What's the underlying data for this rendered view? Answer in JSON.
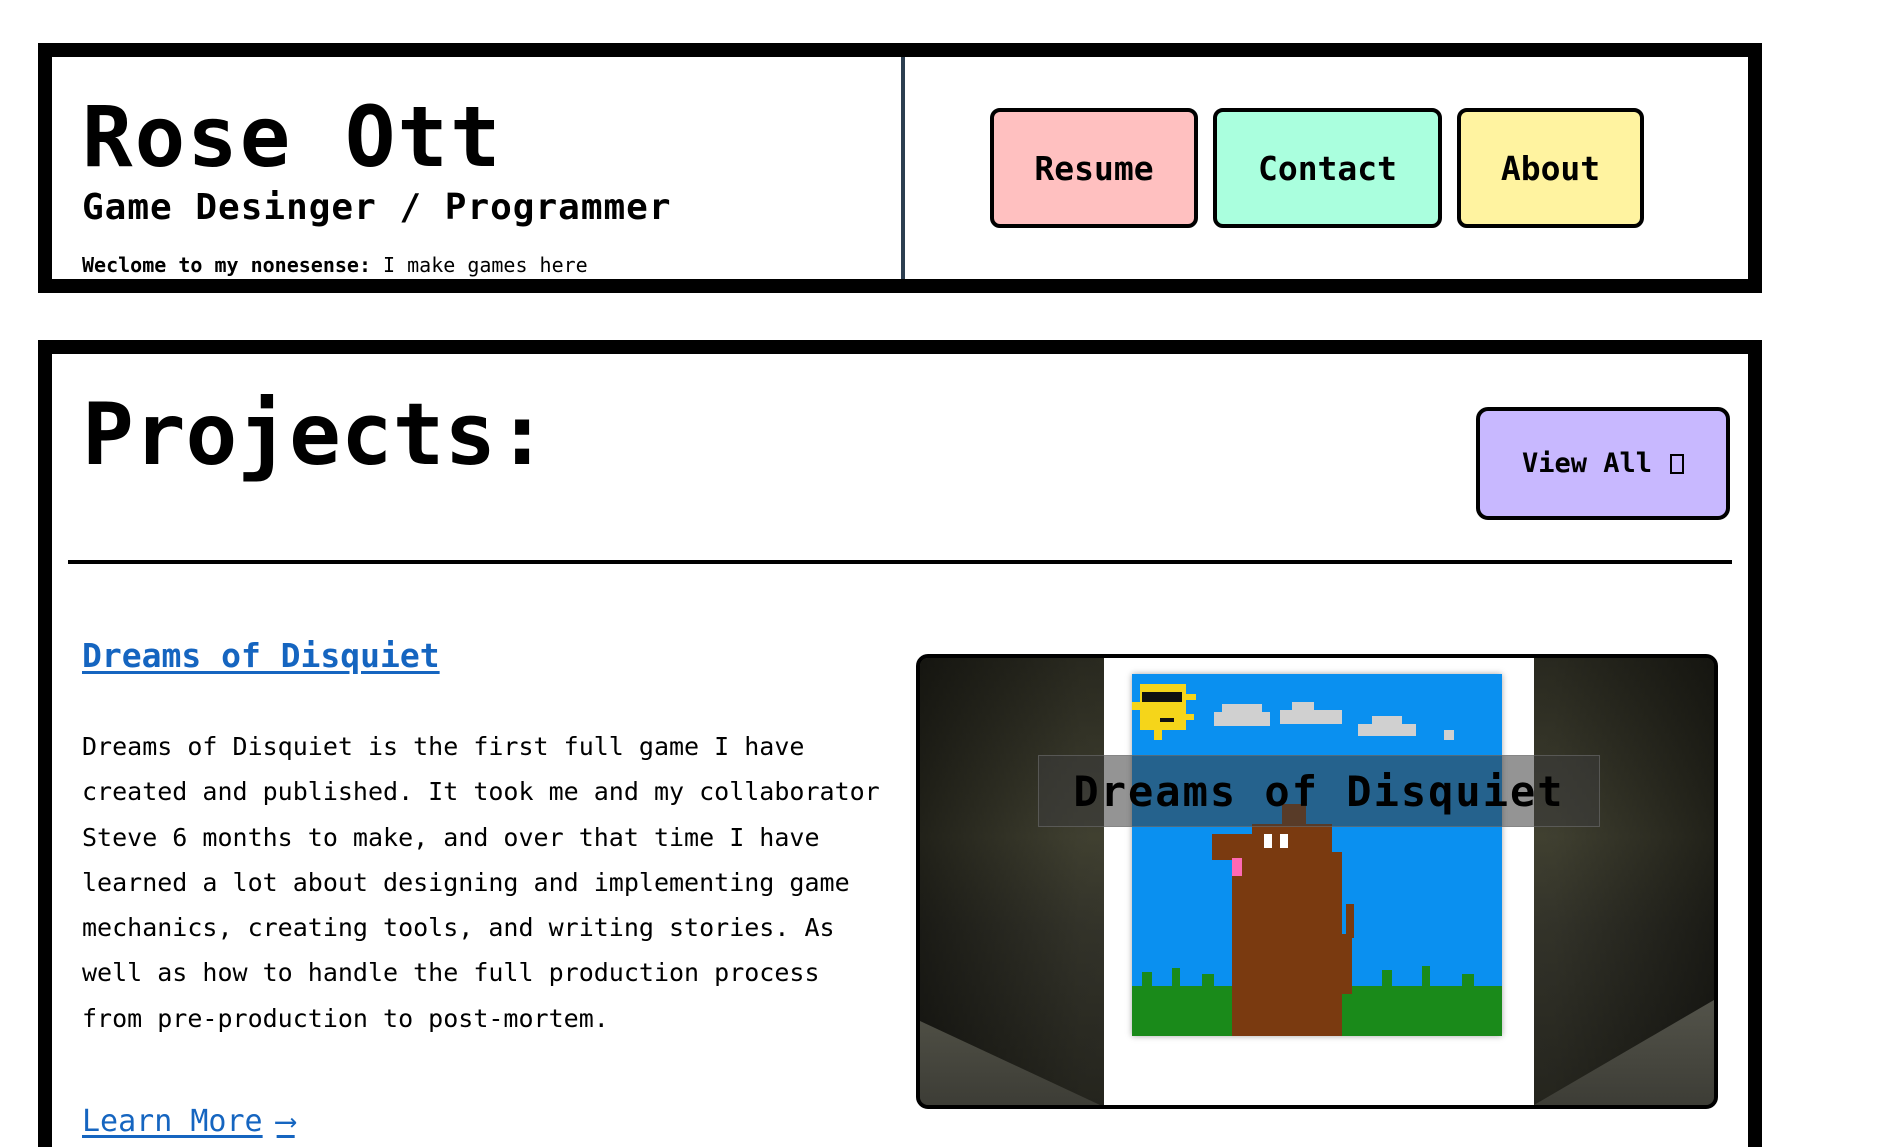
{
  "header": {
    "name": "Rose Ott",
    "role": "Game Desinger / Programmer",
    "tagline_bold": "Weclome to my nonesense:",
    "tagline_rest": " I make games here"
  },
  "nav": [
    {
      "label": "Resume",
      "color": "#ffc0c0"
    },
    {
      "label": "Contact",
      "color": "#aaffde"
    },
    {
      "label": "About",
      "color": "#fff3a0"
    }
  ],
  "projects": {
    "heading": "Projects:",
    "view_all_label": "View All",
    "view_all_icon": "open-link-icon",
    "view_all_color": "#c8b8ff",
    "items": [
      {
        "title": "Dreams of Disquiet",
        "description": "Dreams of Disquiet is the first full game I have created and published. It took me and my collaborator Steve 6 months to make, and over that time I have learned a lot about designing and implementing game mechanics, creating tools, and writing stories. As well as how to handle the full production process from pre-production to post-mortem.",
        "learn_more_label": "Learn More",
        "learn_more_icon": "long-arrow-right-icon",
        "learn_more_arrow": "⟶",
        "image_caption": "Dreams of Disquiet"
      }
    ]
  },
  "colors": {
    "link": "#1565c0",
    "border": "#000000",
    "header_divider": "#2c3e50",
    "sky": "#0a90f0",
    "grass": "#1a8a1a",
    "dog": "#7a3a10"
  }
}
